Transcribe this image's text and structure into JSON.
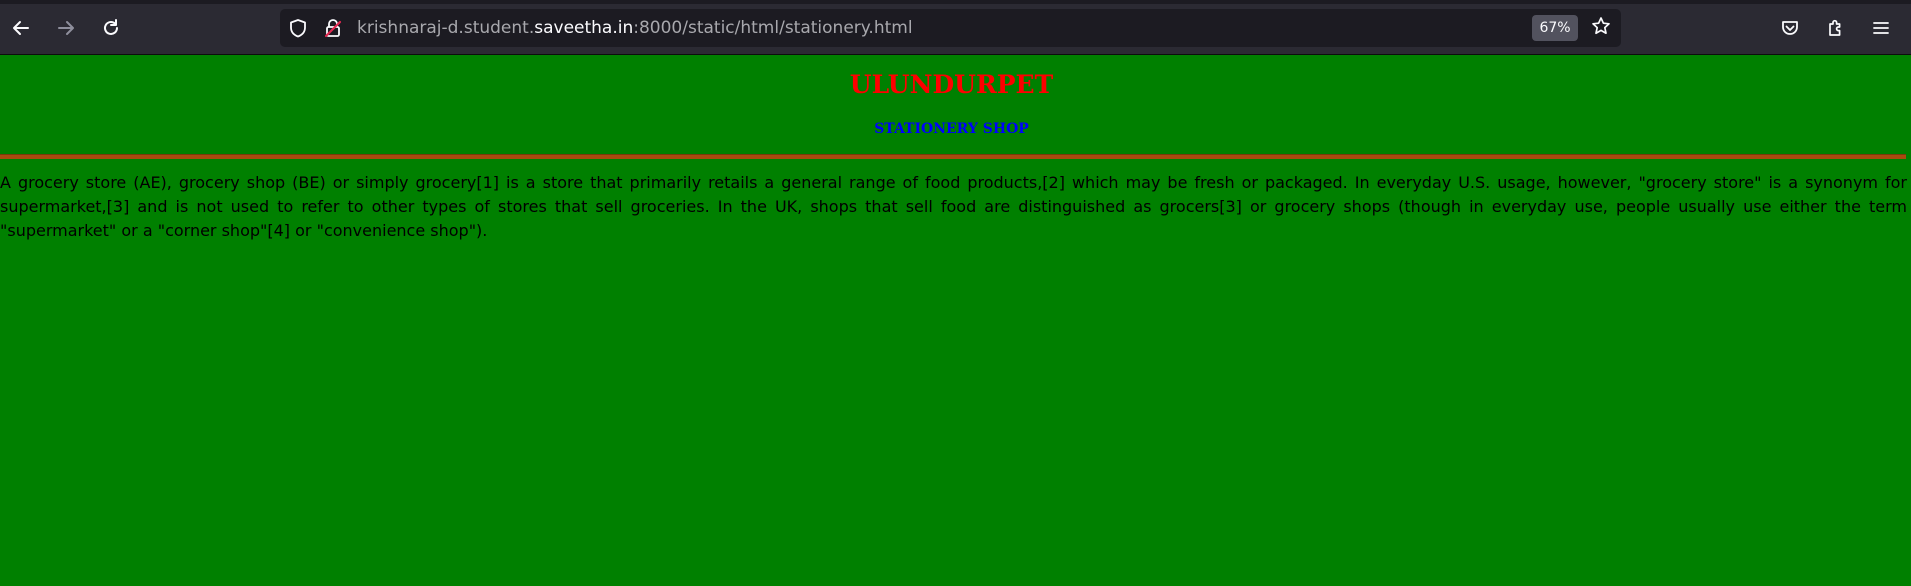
{
  "browser": {
    "url_prefix": "krishnaraj-d.student.",
    "url_host": "saveetha.in",
    "url_suffix": ":8000/static/html/stationery.html",
    "zoom_level": "67%",
    "icons": {
      "back": "back-arrow-icon",
      "forward": "forward-arrow-icon",
      "reload": "reload-icon",
      "tracking": "shield-icon",
      "security": "insecure-lock-icon",
      "bookmark": "star-icon",
      "pocket": "pocket-icon",
      "extensions": "puzzle-icon",
      "menu": "hamburger-menu-icon"
    }
  },
  "page": {
    "title": "ULUNDURPET",
    "subtitle": "STATIONERY SHOP",
    "paragraph": "A grocery store (AE), grocery shop (BE) or simply grocery[1] is a store that primarily retails a general range of food products,[2] which may be fresh or packaged. In everyday U.S. usage, however, \"grocery store\" is a synonym for supermarket,[3] and is not used to refer to other types of stores that sell groceries. In the UK, shops that sell food are distinguished as grocers[3] or grocery shops (though in everyday use, people usually use either the term \"supermarket\" or a \"corner shop\"[4] or \"convenience shop\").",
    "colors": {
      "background": "#008000",
      "title": "#ff0000",
      "subtitle": "#0000ff",
      "divider": "#a94a0f",
      "text": "#000000"
    }
  }
}
